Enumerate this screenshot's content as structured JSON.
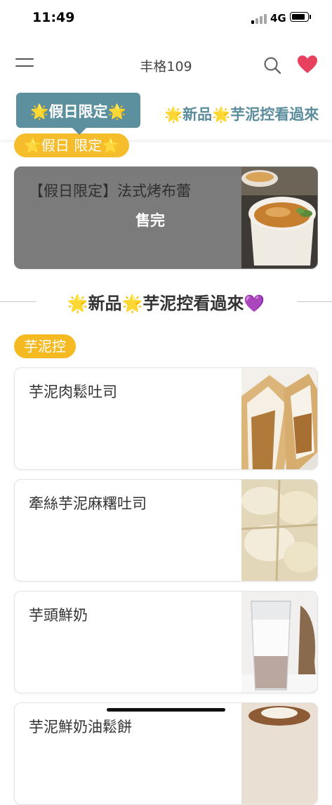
{
  "status_bar": {
    "time": "11:49",
    "network": "4G"
  },
  "header": {
    "title": "丰格109"
  },
  "category_tabs": [
    {
      "label": "🌟假日限定🌟"
    },
    {
      "label": "🌟新品🌟芋泥控看過來"
    }
  ],
  "section_holiday": {
    "tag": "🌟假日 限定🌟"
  },
  "sold_item": {
    "name": "【假日限定】法式烤布蕾",
    "status": "售完"
  },
  "section_new": {
    "title": "🌟新品🌟芋泥控看過來💜",
    "tag": "芋泥控"
  },
  "menu_items": [
    {
      "name": "芋泥肉鬆吐司"
    },
    {
      "name": "牽絲芋泥麻糬吐司"
    },
    {
      "name": "芋頭鮮奶"
    },
    {
      "name": "芋泥鮮奶油鬆餅"
    }
  ],
  "colors": {
    "accent_teal": "#5d909f",
    "tag_yellow": "#f5b921",
    "heart_red": "#e8415f"
  }
}
